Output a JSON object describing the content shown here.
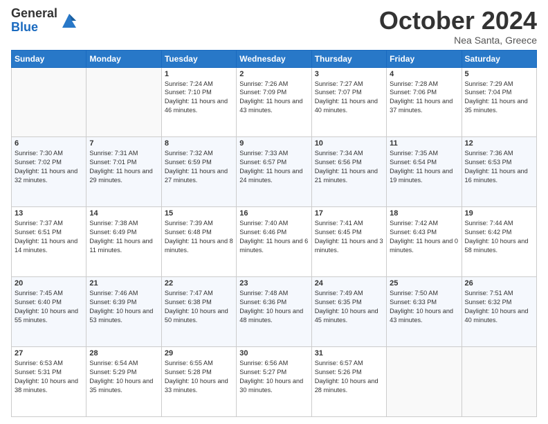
{
  "header": {
    "logo_general": "General",
    "logo_blue": "Blue",
    "month_title": "October 2024",
    "subtitle": "Nea Santa, Greece"
  },
  "weekdays": [
    "Sunday",
    "Monday",
    "Tuesday",
    "Wednesday",
    "Thursday",
    "Friday",
    "Saturday"
  ],
  "weeks": [
    [
      {
        "day": "",
        "sunrise": "",
        "sunset": "",
        "daylight": ""
      },
      {
        "day": "",
        "sunrise": "",
        "sunset": "",
        "daylight": ""
      },
      {
        "day": "1",
        "sunrise": "Sunrise: 7:24 AM",
        "sunset": "Sunset: 7:10 PM",
        "daylight": "Daylight: 11 hours and 46 minutes."
      },
      {
        "day": "2",
        "sunrise": "Sunrise: 7:26 AM",
        "sunset": "Sunset: 7:09 PM",
        "daylight": "Daylight: 11 hours and 43 minutes."
      },
      {
        "day": "3",
        "sunrise": "Sunrise: 7:27 AM",
        "sunset": "Sunset: 7:07 PM",
        "daylight": "Daylight: 11 hours and 40 minutes."
      },
      {
        "day": "4",
        "sunrise": "Sunrise: 7:28 AM",
        "sunset": "Sunset: 7:06 PM",
        "daylight": "Daylight: 11 hours and 37 minutes."
      },
      {
        "day": "5",
        "sunrise": "Sunrise: 7:29 AM",
        "sunset": "Sunset: 7:04 PM",
        "daylight": "Daylight: 11 hours and 35 minutes."
      }
    ],
    [
      {
        "day": "6",
        "sunrise": "Sunrise: 7:30 AM",
        "sunset": "Sunset: 7:02 PM",
        "daylight": "Daylight: 11 hours and 32 minutes."
      },
      {
        "day": "7",
        "sunrise": "Sunrise: 7:31 AM",
        "sunset": "Sunset: 7:01 PM",
        "daylight": "Daylight: 11 hours and 29 minutes."
      },
      {
        "day": "8",
        "sunrise": "Sunrise: 7:32 AM",
        "sunset": "Sunset: 6:59 PM",
        "daylight": "Daylight: 11 hours and 27 minutes."
      },
      {
        "day": "9",
        "sunrise": "Sunrise: 7:33 AM",
        "sunset": "Sunset: 6:57 PM",
        "daylight": "Daylight: 11 hours and 24 minutes."
      },
      {
        "day": "10",
        "sunrise": "Sunrise: 7:34 AM",
        "sunset": "Sunset: 6:56 PM",
        "daylight": "Daylight: 11 hours and 21 minutes."
      },
      {
        "day": "11",
        "sunrise": "Sunrise: 7:35 AM",
        "sunset": "Sunset: 6:54 PM",
        "daylight": "Daylight: 11 hours and 19 minutes."
      },
      {
        "day": "12",
        "sunrise": "Sunrise: 7:36 AM",
        "sunset": "Sunset: 6:53 PM",
        "daylight": "Daylight: 11 hours and 16 minutes."
      }
    ],
    [
      {
        "day": "13",
        "sunrise": "Sunrise: 7:37 AM",
        "sunset": "Sunset: 6:51 PM",
        "daylight": "Daylight: 11 hours and 14 minutes."
      },
      {
        "day": "14",
        "sunrise": "Sunrise: 7:38 AM",
        "sunset": "Sunset: 6:49 PM",
        "daylight": "Daylight: 11 hours and 11 minutes."
      },
      {
        "day": "15",
        "sunrise": "Sunrise: 7:39 AM",
        "sunset": "Sunset: 6:48 PM",
        "daylight": "Daylight: 11 hours and 8 minutes."
      },
      {
        "day": "16",
        "sunrise": "Sunrise: 7:40 AM",
        "sunset": "Sunset: 6:46 PM",
        "daylight": "Daylight: 11 hours and 6 minutes."
      },
      {
        "day": "17",
        "sunrise": "Sunrise: 7:41 AM",
        "sunset": "Sunset: 6:45 PM",
        "daylight": "Daylight: 11 hours and 3 minutes."
      },
      {
        "day": "18",
        "sunrise": "Sunrise: 7:42 AM",
        "sunset": "Sunset: 6:43 PM",
        "daylight": "Daylight: 11 hours and 0 minutes."
      },
      {
        "day": "19",
        "sunrise": "Sunrise: 7:44 AM",
        "sunset": "Sunset: 6:42 PM",
        "daylight": "Daylight: 10 hours and 58 minutes."
      }
    ],
    [
      {
        "day": "20",
        "sunrise": "Sunrise: 7:45 AM",
        "sunset": "Sunset: 6:40 PM",
        "daylight": "Daylight: 10 hours and 55 minutes."
      },
      {
        "day": "21",
        "sunrise": "Sunrise: 7:46 AM",
        "sunset": "Sunset: 6:39 PM",
        "daylight": "Daylight: 10 hours and 53 minutes."
      },
      {
        "day": "22",
        "sunrise": "Sunrise: 7:47 AM",
        "sunset": "Sunset: 6:38 PM",
        "daylight": "Daylight: 10 hours and 50 minutes."
      },
      {
        "day": "23",
        "sunrise": "Sunrise: 7:48 AM",
        "sunset": "Sunset: 6:36 PM",
        "daylight": "Daylight: 10 hours and 48 minutes."
      },
      {
        "day": "24",
        "sunrise": "Sunrise: 7:49 AM",
        "sunset": "Sunset: 6:35 PM",
        "daylight": "Daylight: 10 hours and 45 minutes."
      },
      {
        "day": "25",
        "sunrise": "Sunrise: 7:50 AM",
        "sunset": "Sunset: 6:33 PM",
        "daylight": "Daylight: 10 hours and 43 minutes."
      },
      {
        "day": "26",
        "sunrise": "Sunrise: 7:51 AM",
        "sunset": "Sunset: 6:32 PM",
        "daylight": "Daylight: 10 hours and 40 minutes."
      }
    ],
    [
      {
        "day": "27",
        "sunrise": "Sunrise: 6:53 AM",
        "sunset": "Sunset: 5:31 PM",
        "daylight": "Daylight: 10 hours and 38 minutes."
      },
      {
        "day": "28",
        "sunrise": "Sunrise: 6:54 AM",
        "sunset": "Sunset: 5:29 PM",
        "daylight": "Daylight: 10 hours and 35 minutes."
      },
      {
        "day": "29",
        "sunrise": "Sunrise: 6:55 AM",
        "sunset": "Sunset: 5:28 PM",
        "daylight": "Daylight: 10 hours and 33 minutes."
      },
      {
        "day": "30",
        "sunrise": "Sunrise: 6:56 AM",
        "sunset": "Sunset: 5:27 PM",
        "daylight": "Daylight: 10 hours and 30 minutes."
      },
      {
        "day": "31",
        "sunrise": "Sunrise: 6:57 AM",
        "sunset": "Sunset: 5:26 PM",
        "daylight": "Daylight: 10 hours and 28 minutes."
      },
      {
        "day": "",
        "sunrise": "",
        "sunset": "",
        "daylight": ""
      },
      {
        "day": "",
        "sunrise": "",
        "sunset": "",
        "daylight": ""
      }
    ]
  ]
}
